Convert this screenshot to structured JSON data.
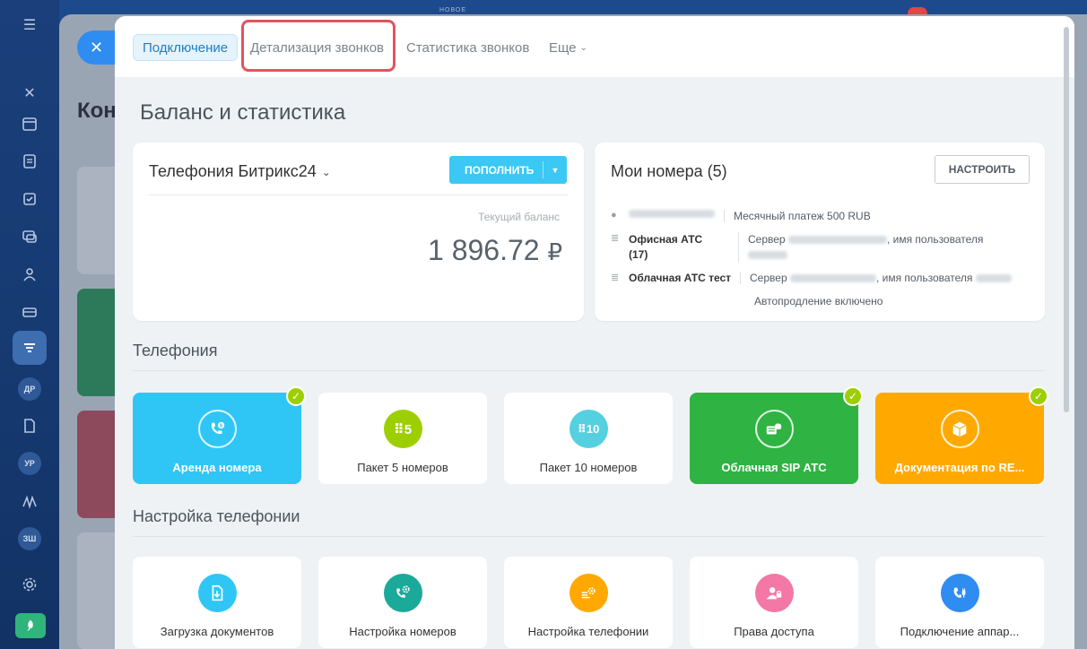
{
  "background": {
    "title": "Кон",
    "top_label": "НОВОЕ"
  },
  "sidebar": {
    "badges": [
      "ДР",
      "УР",
      "ЗШ"
    ]
  },
  "tabs": [
    {
      "label": "Подключение"
    },
    {
      "label": "Детализация звонков"
    },
    {
      "label": "Статистика звонков"
    },
    {
      "label": "Еще"
    }
  ],
  "page": {
    "title": "Баланс и статистика"
  },
  "balance": {
    "title": "Телефония Битрикс24",
    "topup_label": "ПОПОЛНИТЬ",
    "label": "Текущий баланс",
    "value": "1 896.72",
    "currency": "₽"
  },
  "numbers": {
    "title": "Мои номера (5)",
    "config_label": "НАСТРОИТЬ",
    "monthly": "Месячный платеж 500 RUB",
    "office_name": "Офисная АТС",
    "office_count": "(17)",
    "office_server": "Сервер",
    "office_user": ", имя пользователя",
    "cloud_name": "Облачная АТС тест",
    "cloud_server": "Сервер",
    "cloud_user": ", имя пользователя",
    "autorenew": "Автопродление включено"
  },
  "telephony": {
    "title": "Телефония",
    "tiles": [
      {
        "label": "Аренда номера",
        "icon": "phone-rent-icon",
        "color": "#2fc6f6",
        "checked": true
      },
      {
        "label": "Пакет 5 номеров",
        "icon": "grid-5-icon",
        "color": "#9dcf00",
        "glyph": "⠿5",
        "checked": false
      },
      {
        "label": "Пакет 10 номеров",
        "icon": "grid-10-icon",
        "color": "#55d0e0",
        "glyph": "⠿10",
        "checked": false
      },
      {
        "label": "Облачная SIP АТС",
        "icon": "cloud-sip-icon",
        "color": "#2fb343",
        "checked": true
      },
      {
        "label": "Документация по RE...",
        "icon": "box-doc-icon",
        "color": "#ffa900",
        "checked": true
      }
    ]
  },
  "settings": {
    "title": "Настройка телефонии",
    "tiles": [
      {
        "label": "Загрузка документов",
        "icon": "upload-doc-icon",
        "color": "#2fc6f6"
      },
      {
        "label": "Настройка номеров",
        "icon": "phone-gear-icon",
        "color": "#1ba99a"
      },
      {
        "label": "Настройка телефонии",
        "icon": "telephony-gear-icon",
        "color": "#ffa900"
      },
      {
        "label": "Права доступа",
        "icon": "access-rights-icon",
        "color": "#f378a6"
      },
      {
        "label": "Подключение аппар...",
        "icon": "plug-device-icon",
        "color": "#2f8cf0"
      }
    ]
  }
}
